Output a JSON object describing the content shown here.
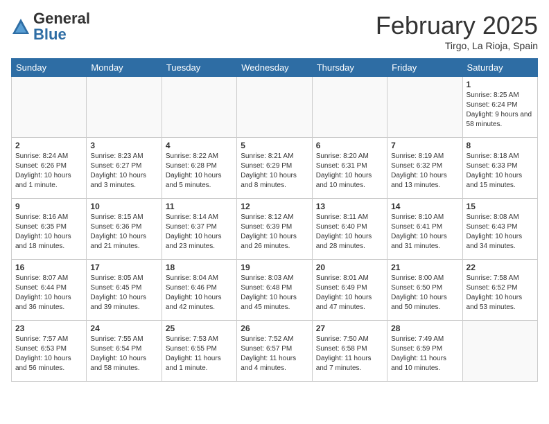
{
  "header": {
    "logo_general": "General",
    "logo_blue": "Blue",
    "month_title": "February 2025",
    "subtitle": "Tirgo, La Rioja, Spain"
  },
  "days_of_week": [
    "Sunday",
    "Monday",
    "Tuesday",
    "Wednesday",
    "Thursday",
    "Friday",
    "Saturday"
  ],
  "weeks": [
    [
      {
        "num": "",
        "info": ""
      },
      {
        "num": "",
        "info": ""
      },
      {
        "num": "",
        "info": ""
      },
      {
        "num": "",
        "info": ""
      },
      {
        "num": "",
        "info": ""
      },
      {
        "num": "",
        "info": ""
      },
      {
        "num": "1",
        "info": "Sunrise: 8:25 AM\nSunset: 6:24 PM\nDaylight: 9 hours and 58 minutes."
      }
    ],
    [
      {
        "num": "2",
        "info": "Sunrise: 8:24 AM\nSunset: 6:26 PM\nDaylight: 10 hours and 1 minute."
      },
      {
        "num": "3",
        "info": "Sunrise: 8:23 AM\nSunset: 6:27 PM\nDaylight: 10 hours and 3 minutes."
      },
      {
        "num": "4",
        "info": "Sunrise: 8:22 AM\nSunset: 6:28 PM\nDaylight: 10 hours and 5 minutes."
      },
      {
        "num": "5",
        "info": "Sunrise: 8:21 AM\nSunset: 6:29 PM\nDaylight: 10 hours and 8 minutes."
      },
      {
        "num": "6",
        "info": "Sunrise: 8:20 AM\nSunset: 6:31 PM\nDaylight: 10 hours and 10 minutes."
      },
      {
        "num": "7",
        "info": "Sunrise: 8:19 AM\nSunset: 6:32 PM\nDaylight: 10 hours and 13 minutes."
      },
      {
        "num": "8",
        "info": "Sunrise: 8:18 AM\nSunset: 6:33 PM\nDaylight: 10 hours and 15 minutes."
      }
    ],
    [
      {
        "num": "9",
        "info": "Sunrise: 8:16 AM\nSunset: 6:35 PM\nDaylight: 10 hours and 18 minutes."
      },
      {
        "num": "10",
        "info": "Sunrise: 8:15 AM\nSunset: 6:36 PM\nDaylight: 10 hours and 21 minutes."
      },
      {
        "num": "11",
        "info": "Sunrise: 8:14 AM\nSunset: 6:37 PM\nDaylight: 10 hours and 23 minutes."
      },
      {
        "num": "12",
        "info": "Sunrise: 8:12 AM\nSunset: 6:39 PM\nDaylight: 10 hours and 26 minutes."
      },
      {
        "num": "13",
        "info": "Sunrise: 8:11 AM\nSunset: 6:40 PM\nDaylight: 10 hours and 28 minutes."
      },
      {
        "num": "14",
        "info": "Sunrise: 8:10 AM\nSunset: 6:41 PM\nDaylight: 10 hours and 31 minutes."
      },
      {
        "num": "15",
        "info": "Sunrise: 8:08 AM\nSunset: 6:43 PM\nDaylight: 10 hours and 34 minutes."
      }
    ],
    [
      {
        "num": "16",
        "info": "Sunrise: 8:07 AM\nSunset: 6:44 PM\nDaylight: 10 hours and 36 minutes."
      },
      {
        "num": "17",
        "info": "Sunrise: 8:05 AM\nSunset: 6:45 PM\nDaylight: 10 hours and 39 minutes."
      },
      {
        "num": "18",
        "info": "Sunrise: 8:04 AM\nSunset: 6:46 PM\nDaylight: 10 hours and 42 minutes."
      },
      {
        "num": "19",
        "info": "Sunrise: 8:03 AM\nSunset: 6:48 PM\nDaylight: 10 hours and 45 minutes."
      },
      {
        "num": "20",
        "info": "Sunrise: 8:01 AM\nSunset: 6:49 PM\nDaylight: 10 hours and 47 minutes."
      },
      {
        "num": "21",
        "info": "Sunrise: 8:00 AM\nSunset: 6:50 PM\nDaylight: 10 hours and 50 minutes."
      },
      {
        "num": "22",
        "info": "Sunrise: 7:58 AM\nSunset: 6:52 PM\nDaylight: 10 hours and 53 minutes."
      }
    ],
    [
      {
        "num": "23",
        "info": "Sunrise: 7:57 AM\nSunset: 6:53 PM\nDaylight: 10 hours and 56 minutes."
      },
      {
        "num": "24",
        "info": "Sunrise: 7:55 AM\nSunset: 6:54 PM\nDaylight: 10 hours and 58 minutes."
      },
      {
        "num": "25",
        "info": "Sunrise: 7:53 AM\nSunset: 6:55 PM\nDaylight: 11 hours and 1 minute."
      },
      {
        "num": "26",
        "info": "Sunrise: 7:52 AM\nSunset: 6:57 PM\nDaylight: 11 hours and 4 minutes."
      },
      {
        "num": "27",
        "info": "Sunrise: 7:50 AM\nSunset: 6:58 PM\nDaylight: 11 hours and 7 minutes."
      },
      {
        "num": "28",
        "info": "Sunrise: 7:49 AM\nSunset: 6:59 PM\nDaylight: 11 hours and 10 minutes."
      },
      {
        "num": "",
        "info": ""
      }
    ]
  ]
}
